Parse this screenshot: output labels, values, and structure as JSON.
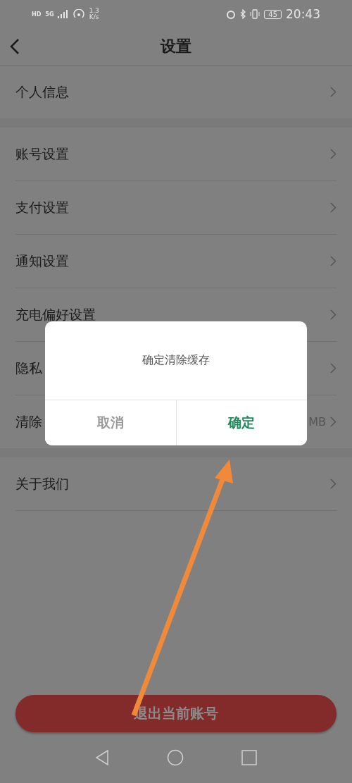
{
  "status_bar": {
    "badges": [
      "HD",
      "5G"
    ],
    "speed": [
      "1.3",
      "K/s"
    ],
    "battery": "45",
    "time": "20:43"
  },
  "header": {
    "title": "设置"
  },
  "sections": [
    {
      "items": [
        {
          "label": "个人信息"
        }
      ]
    },
    {
      "items": [
        {
          "label": "账号设置"
        },
        {
          "label": "支付设置"
        },
        {
          "label": "通知设置"
        },
        {
          "label": "充电偏好设置"
        },
        {
          "label": "隐私"
        },
        {
          "label": "清除",
          "value": "MB"
        }
      ]
    },
    {
      "items": [
        {
          "label": "关于我们"
        }
      ]
    }
  ],
  "logout_button": "退出当前账号",
  "dialog": {
    "message": "确定清除缓存",
    "buttons": [
      {
        "label": "取消",
        "kind": "cancel"
      },
      {
        "label": "确定",
        "kind": "confirm"
      }
    ]
  }
}
